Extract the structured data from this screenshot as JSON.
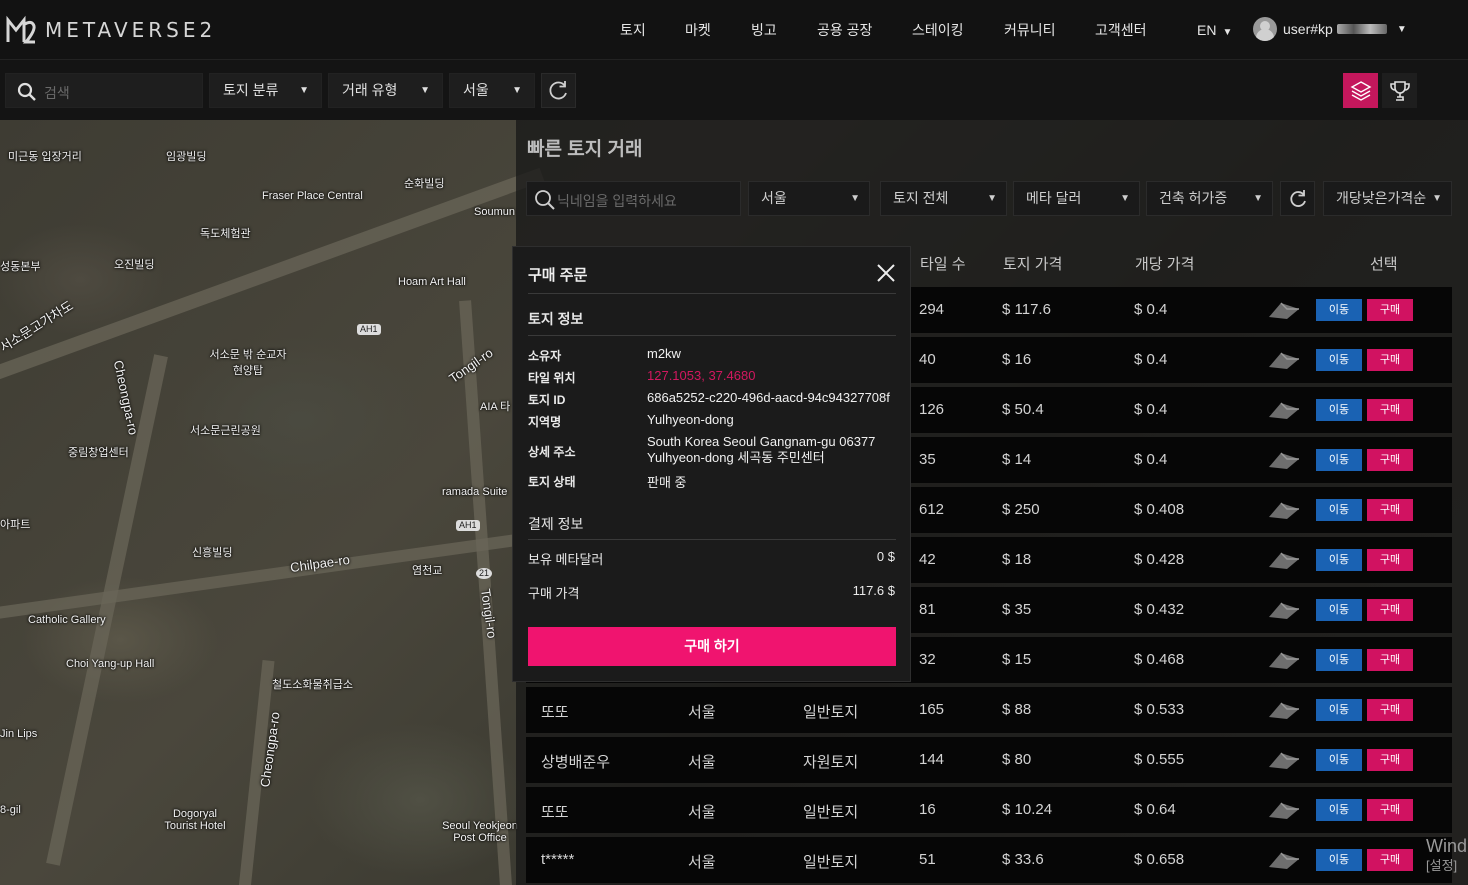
{
  "header": {
    "logo_text": "METAVERSE2",
    "nav": [
      "토지",
      "마켓",
      "빙고",
      "공용 공장",
      "스테이킹",
      "커뮤니티",
      "고객센터"
    ],
    "lang": "EN",
    "user_prefix": "user#kp"
  },
  "filters": {
    "search_placeholder": "검색",
    "land_type": "토지 분류",
    "trade_type": "거래 유형",
    "region": "서울"
  },
  "map": {
    "labels": [
      "미근동 입장거리",
      "임광빌딩",
      "Fraser Place Central",
      "순화빌딩",
      "Soumun",
      "독도체험관",
      "성동본부",
      "오진빌딩",
      "Hoam Art Hall",
      "서소문고가차도",
      "서소문 밖 순교자 현양탑",
      "Tongil-ro",
      "Cheongpa-ro",
      "AIA 타",
      "서소문근린공원",
      "중림창업센터",
      "ramada Suite",
      "신흥빌딩",
      "Chilpae-ro",
      "염천교",
      "Catholic Gallery",
      "Choi Yang-up Hall",
      "철도소화물취급소",
      "Jin Lips",
      "Cheongpa-ro",
      "Tongil-ro",
      "Dogoryal Tourist Hotel",
      "Seoul Yeokjeon Post Office",
      "아파트",
      "8-gil"
    ],
    "shields": [
      "AH1",
      "AH1",
      "21"
    ]
  },
  "panel": {
    "title": "빠른 토지 거래",
    "search_placeholder": "닉네임을 입력하세요",
    "filter_region": "서울",
    "filter_land": "토지 전체",
    "filter_currency": "메타 달러",
    "filter_permit": "건축 허가증",
    "filter_sort": "개당낮은가격순",
    "columns": {
      "tiles": "타일 수",
      "price": "토지 가격",
      "unit": "개당 가격",
      "select": "선택"
    },
    "move_label": "이동",
    "buy_label": "구매",
    "rows": [
      {
        "owner": "",
        "region": "",
        "type": "",
        "tiles": "294",
        "price": "$ 117.6",
        "unit": "$ 0.4"
      },
      {
        "owner": "",
        "region": "",
        "type": "",
        "tiles": "40",
        "price": "$ 16",
        "unit": "$ 0.4"
      },
      {
        "owner": "",
        "region": "",
        "type": "",
        "tiles": "126",
        "price": "$ 50.4",
        "unit": "$ 0.4"
      },
      {
        "owner": "",
        "region": "",
        "type": "",
        "tiles": "35",
        "price": "$ 14",
        "unit": "$ 0.4"
      },
      {
        "owner": "",
        "region": "",
        "type": "",
        "tiles": "612",
        "price": "$ 250",
        "unit": "$ 0.408"
      },
      {
        "owner": "",
        "region": "",
        "type": "",
        "tiles": "42",
        "price": "$ 18",
        "unit": "$ 0.428"
      },
      {
        "owner": "",
        "region": "",
        "type": "",
        "tiles": "81",
        "price": "$ 35",
        "unit": "$ 0.432"
      },
      {
        "owner": "",
        "region": "",
        "type": "",
        "tiles": "32",
        "price": "$ 15",
        "unit": "$ 0.468"
      },
      {
        "owner": "또또",
        "region": "서울",
        "type": "일반토지",
        "tiles": "165",
        "price": "$ 88",
        "unit": "$ 0.533"
      },
      {
        "owner": "상병배준우",
        "region": "서울",
        "type": "자원토지",
        "tiles": "144",
        "price": "$ 80",
        "unit": "$ 0.555"
      },
      {
        "owner": "또또",
        "region": "서울",
        "type": "일반토지",
        "tiles": "16",
        "price": "$ 10.24",
        "unit": "$ 0.64"
      },
      {
        "owner": "t*****",
        "region": "서울",
        "type": "일반토지",
        "tiles": "51",
        "price": "$ 33.6",
        "unit": "$ 0.658"
      }
    ]
  },
  "modal": {
    "title": "구매 주문",
    "land_section": "토지 정보",
    "owner_label": "소유자",
    "owner": "m2kw",
    "tile_label": "타일 위치",
    "tile": "127.1053, 37.4680",
    "id_label": "토지 ID",
    "id": "686a5252-c220-496d-aacd-94c94327708f",
    "area_label": "지역명",
    "area": "Yulhyeon-dong",
    "addr_label": "상세 주소",
    "addr": "South Korea Seoul Gangnam-gu 06377 Yulhyeon-dong 세곡동 주민센터",
    "status_label": "토지 상태",
    "status": "판매 중",
    "pay_section": "결제 정보",
    "balance_label": "보유 메타달러",
    "balance": "0 $",
    "price_label": "구매 가격",
    "price": "117.6 $",
    "buy_button": "구매 하기"
  },
  "os": {
    "watermark": "Wind",
    "settings": "[설정]"
  },
  "colors": {
    "accent": "#f0146f",
    "move": "#1a62b3",
    "buy": "#d11261",
    "link": "#d1185f"
  }
}
